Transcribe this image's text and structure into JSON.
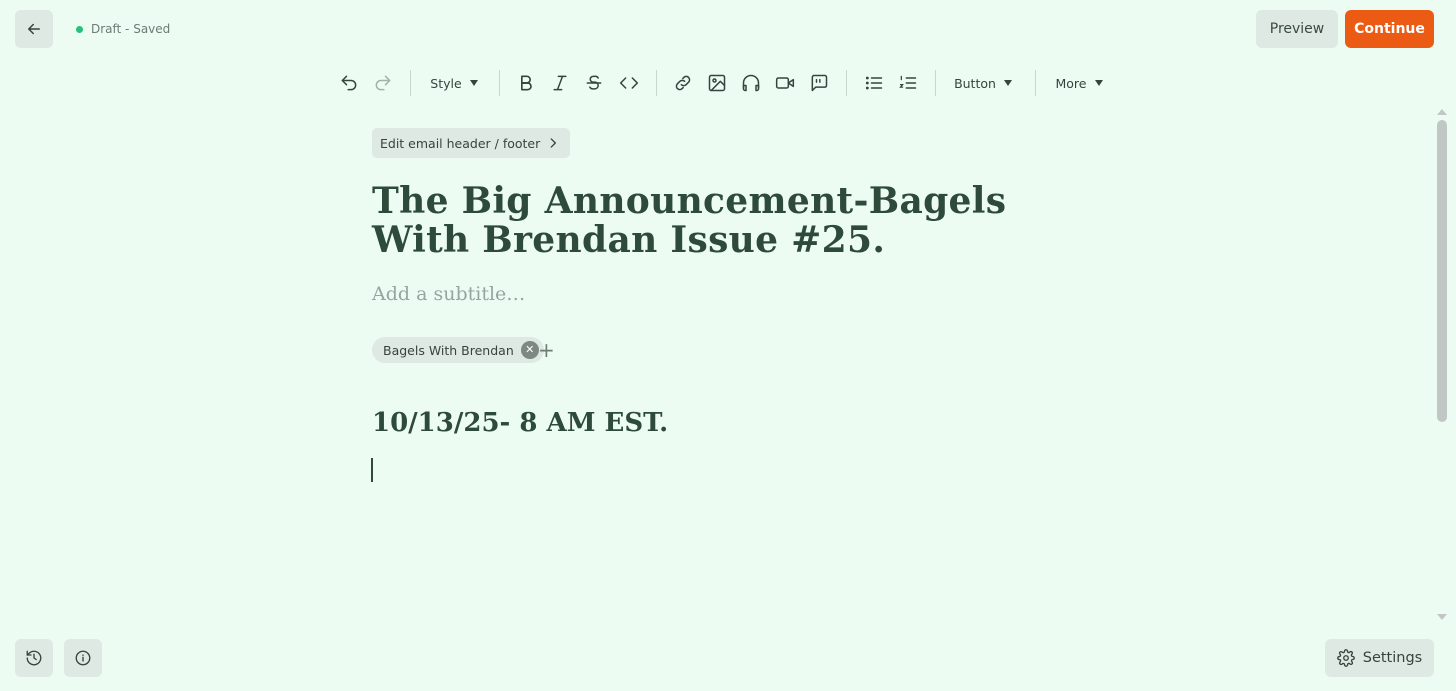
{
  "header": {
    "back_icon": "arrow-left-icon",
    "status": "Draft - Saved",
    "status_color": "#27c07d",
    "preview_label": "Preview",
    "continue_label": "Continue",
    "accent": "#eb5b14"
  },
  "toolbar": {
    "style_label": "Style",
    "button_label": "Button",
    "more_label": "More",
    "icons": [
      "undo-icon",
      "redo-icon",
      "bold-icon",
      "italic-icon",
      "strikethrough-icon",
      "code-icon",
      "link-icon",
      "image-icon",
      "audio-icon",
      "video-icon",
      "quote-icon",
      "bullet-list-icon",
      "numbered-list-icon"
    ]
  },
  "editor": {
    "header_footer_label": "Edit email header / footer",
    "title": "The Big Announcement-Bagels With Brendan Issue #25.",
    "subtitle_placeholder": "Add a subtitle…",
    "tag": "Bagels With Brendan",
    "body_heading": "10/13/25- 8 AM EST."
  },
  "footer": {
    "settings_label": "Settings"
  }
}
